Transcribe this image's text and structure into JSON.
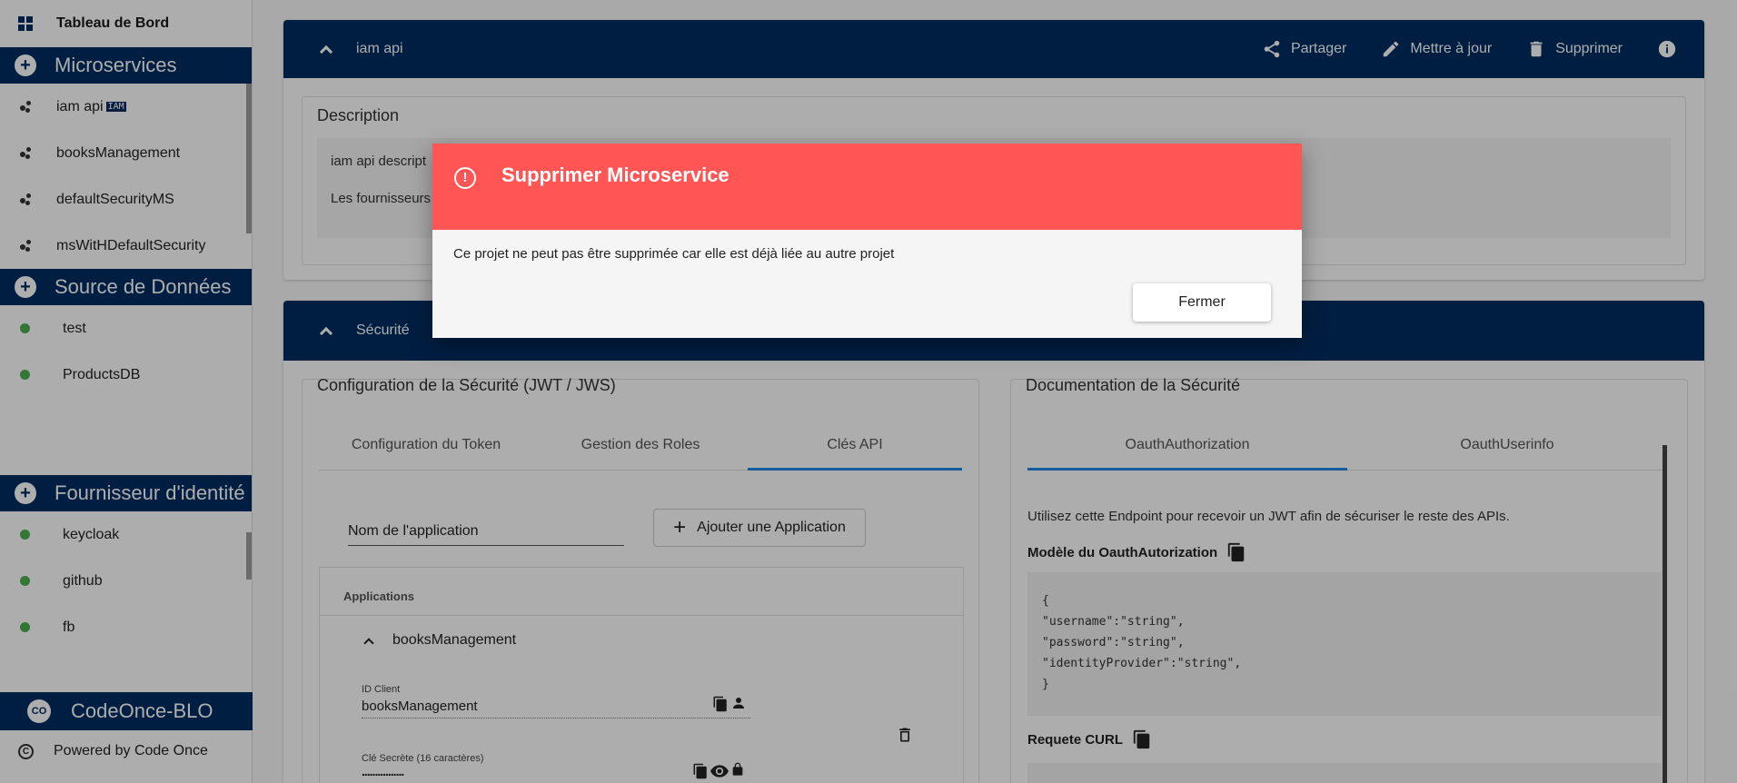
{
  "sidebar": {
    "dashboard_label": "Tableau de Bord",
    "microservices_header": "Microservices",
    "microservices": [
      {
        "label": "iam api",
        "tag": "IAM"
      },
      {
        "label": "booksManagement"
      },
      {
        "label": "defaultSecurityMS"
      },
      {
        "label": "msWitHDefaultSecurity"
      }
    ],
    "datasources_header": "Source de Données",
    "datasources": [
      {
        "label": "test"
      },
      {
        "label": "ProductsDB"
      }
    ],
    "idp_header": "Fournisseur d'identité",
    "idps": [
      {
        "label": "keycloak"
      },
      {
        "label": "github"
      },
      {
        "label": "fb"
      }
    ],
    "footer_badge": "CO",
    "footer_title": "CodeOnce-BLO",
    "powered_by": "Powered by Code Once",
    "copyright_symbol": "C"
  },
  "ms_card": {
    "title": "iam api",
    "actions": {
      "share": "Partager",
      "update": "Mettre à jour",
      "delete": "Supprimer"
    },
    "description_title": "Description",
    "description_line1": "iam api descript",
    "description_line2": "Les fournisseurs"
  },
  "security_card": {
    "title": "Sécurité",
    "config_title": "Configuration de la Sécurité (JWT / JWS)",
    "tabs": [
      "Configuration du Token",
      "Gestion des Roles",
      "Clés API"
    ],
    "active_tab": "Clés API",
    "app_name_value": "Nom de l'application",
    "add_app_label": "Ajouter une Application",
    "applications_header": "Applications",
    "app_name": "booksManagement",
    "client_id_label": "ID Client",
    "client_id_value": "booksManagement",
    "secret_label": "Clé Secrète (16 caractères)",
    "secret_value": "................",
    "doc_title": "Documentation de la Sécurité",
    "doc_tabs": [
      "OauthAuthorization",
      "OauthUserinfo"
    ],
    "doc_active_tab": "OauthAuthorization",
    "doc_intro": "Utilisez cette Endpoint pour recevoir un JWT afin de sécuriser le reste des APIs.",
    "model_label": "Modèle du OauthAutorization",
    "model_code": "{\n\"username\":\"string\",\n\"password\":\"string\",\n\"identityProvider\":\"string\",\n}",
    "curl_label": "Requete CURL"
  },
  "dialog": {
    "title": "Supprimer Microservice",
    "icon": "!",
    "message": "Ce projet ne peut pas être supprimée car elle est déjà liée au autre projet",
    "close_label": "Fermer"
  },
  "colors": {
    "primary": "#002d62",
    "danger": "#ff5555",
    "accent": "#1e88e5",
    "status_green": "#4caf50"
  }
}
